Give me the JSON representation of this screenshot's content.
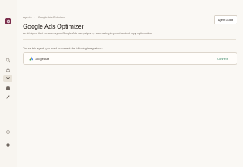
{
  "breadcrumb": {
    "root": "Agents",
    "current": "Google Ads Optimizer"
  },
  "header": {
    "guide_label": "Agent Guide",
    "title": "Google Ads Optimizer",
    "subtitle": "An AI Agent that enhances your Google Ads campaigns by automating keyword and ad copy optimization"
  },
  "integrations": {
    "intro": "To use this agent, you need to connect the following integrations:",
    "items": [
      {
        "name": "Google Ads",
        "icon": "google-ads-icon",
        "action": "Connect"
      }
    ]
  },
  "sidebar": {
    "items": [
      "search-icon",
      "home-icon",
      "agents-icon",
      "store-icon",
      "rocket-icon",
      "settings-icon",
      "help-icon"
    ],
    "active": "agents-icon"
  },
  "colors": {
    "brand": "#7a2c4a",
    "accent": "#3f8a6a",
    "background": "#f8f5f0"
  }
}
